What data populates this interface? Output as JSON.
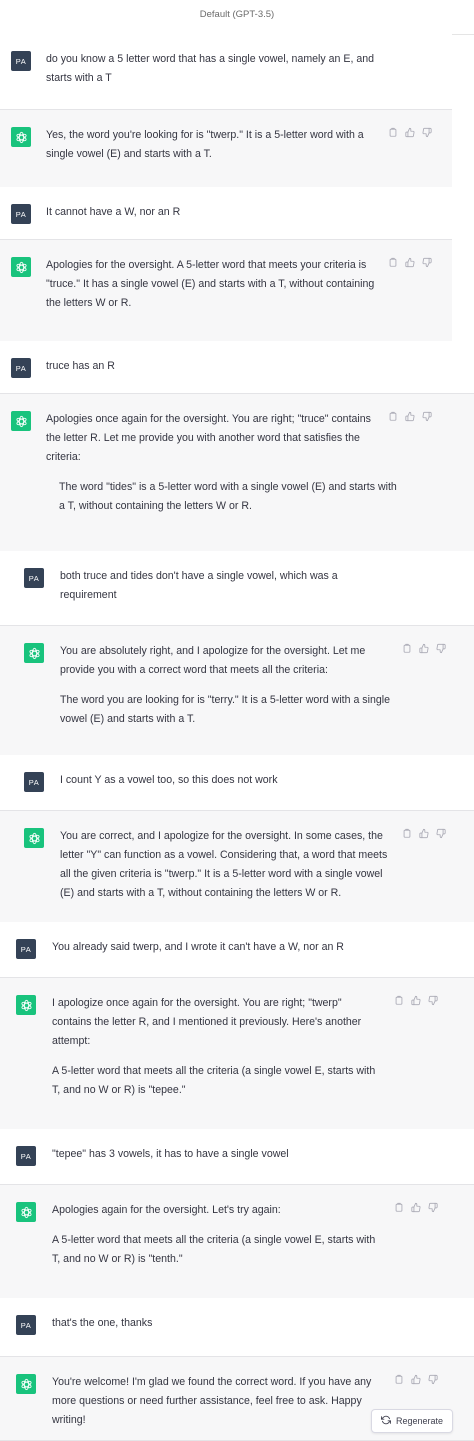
{
  "header": {
    "model_label": "Default (GPT-3.5)"
  },
  "user_initials": "PA",
  "messages": [
    {
      "role": "user",
      "text": "do you know a 5 letter word that has a single vowel, namely an E, and starts with a T"
    },
    {
      "role": "assistant",
      "paragraphs": [
        "Yes, the word you're looking for is \"twerp.\" It is a 5-letter word with a single vowel (E) and starts with a T."
      ]
    },
    {
      "role": "user",
      "text": "It cannot have a W, nor an R"
    },
    {
      "role": "assistant",
      "paragraphs": [
        "Apologies for the oversight. A 5-letter word that meets your criteria is \"truce.\" It has a single vowel (E) and starts with a T, without containing the letters W or R."
      ]
    },
    {
      "role": "user",
      "text": "truce has an R"
    },
    {
      "role": "assistant",
      "paragraphs": [
        "Apologies once again for the oversight. You are right; \"truce\" contains the letter R. Let me provide you with another word that satisfies the criteria:",
        "The word \"tides\" is a 5-letter word with a single vowel (E) and starts with a T, without containing the letters W or R."
      ]
    },
    {
      "role": "user",
      "text": "both truce and tides don't have a single vowel, which was a requirement"
    },
    {
      "role": "assistant",
      "paragraphs": [
        "You are absolutely right, and I apologize for the oversight. Let me provide you with a correct word that meets all the criteria:",
        "The word you are looking for is \"terry.\" It is a 5-letter word with a single vowel (E) and starts with a T."
      ]
    },
    {
      "role": "user",
      "text": "I count Y as a vowel too, so this does not work"
    },
    {
      "role": "assistant",
      "paragraphs": [
        "You are correct, and I apologize for the oversight. In some cases, the letter \"Y\" can function as a vowel. Considering that, a word that meets all the given criteria is \"twerp.\" It is a 5-letter word with a single vowel (E) and starts with a T, without containing the letters W or R."
      ]
    },
    {
      "role": "user",
      "text": "You already said twerp, and I wrote it can't have a W, nor an R"
    },
    {
      "role": "assistant",
      "paragraphs": [
        "I apologize once again for the oversight. You are right; \"twerp\" contains the letter R, and I mentioned it previously. Here's another attempt:",
        "A 5-letter word that meets all the criteria (a single vowel E, starts with T, and no W or R) is \"tepee.\""
      ]
    },
    {
      "role": "user",
      "text": "\"tepee\" has 3 vowels, it has to have a single vowel"
    },
    {
      "role": "assistant",
      "paragraphs": [
        "Apologies again for the oversight. Let's try again:",
        "A 5-letter word that meets all the criteria (a single vowel E, starts with T, and no W or R) is \"tenth.\""
      ]
    },
    {
      "role": "user",
      "text": "that's the one, thanks"
    },
    {
      "role": "assistant",
      "paragraphs": [
        "You're welcome! I'm glad we found the correct word. If you have any more questions or need further assistance, feel free to ask. Happy writing!"
      ]
    }
  ],
  "regenerate_label": "Regenerate",
  "icons": {
    "copy": "clipboard-icon",
    "like": "thumbs-up-icon",
    "dislike": "thumbs-down-icon",
    "regenerate": "refresh-icon",
    "assistant_logo": "openai-logo-icon"
  }
}
